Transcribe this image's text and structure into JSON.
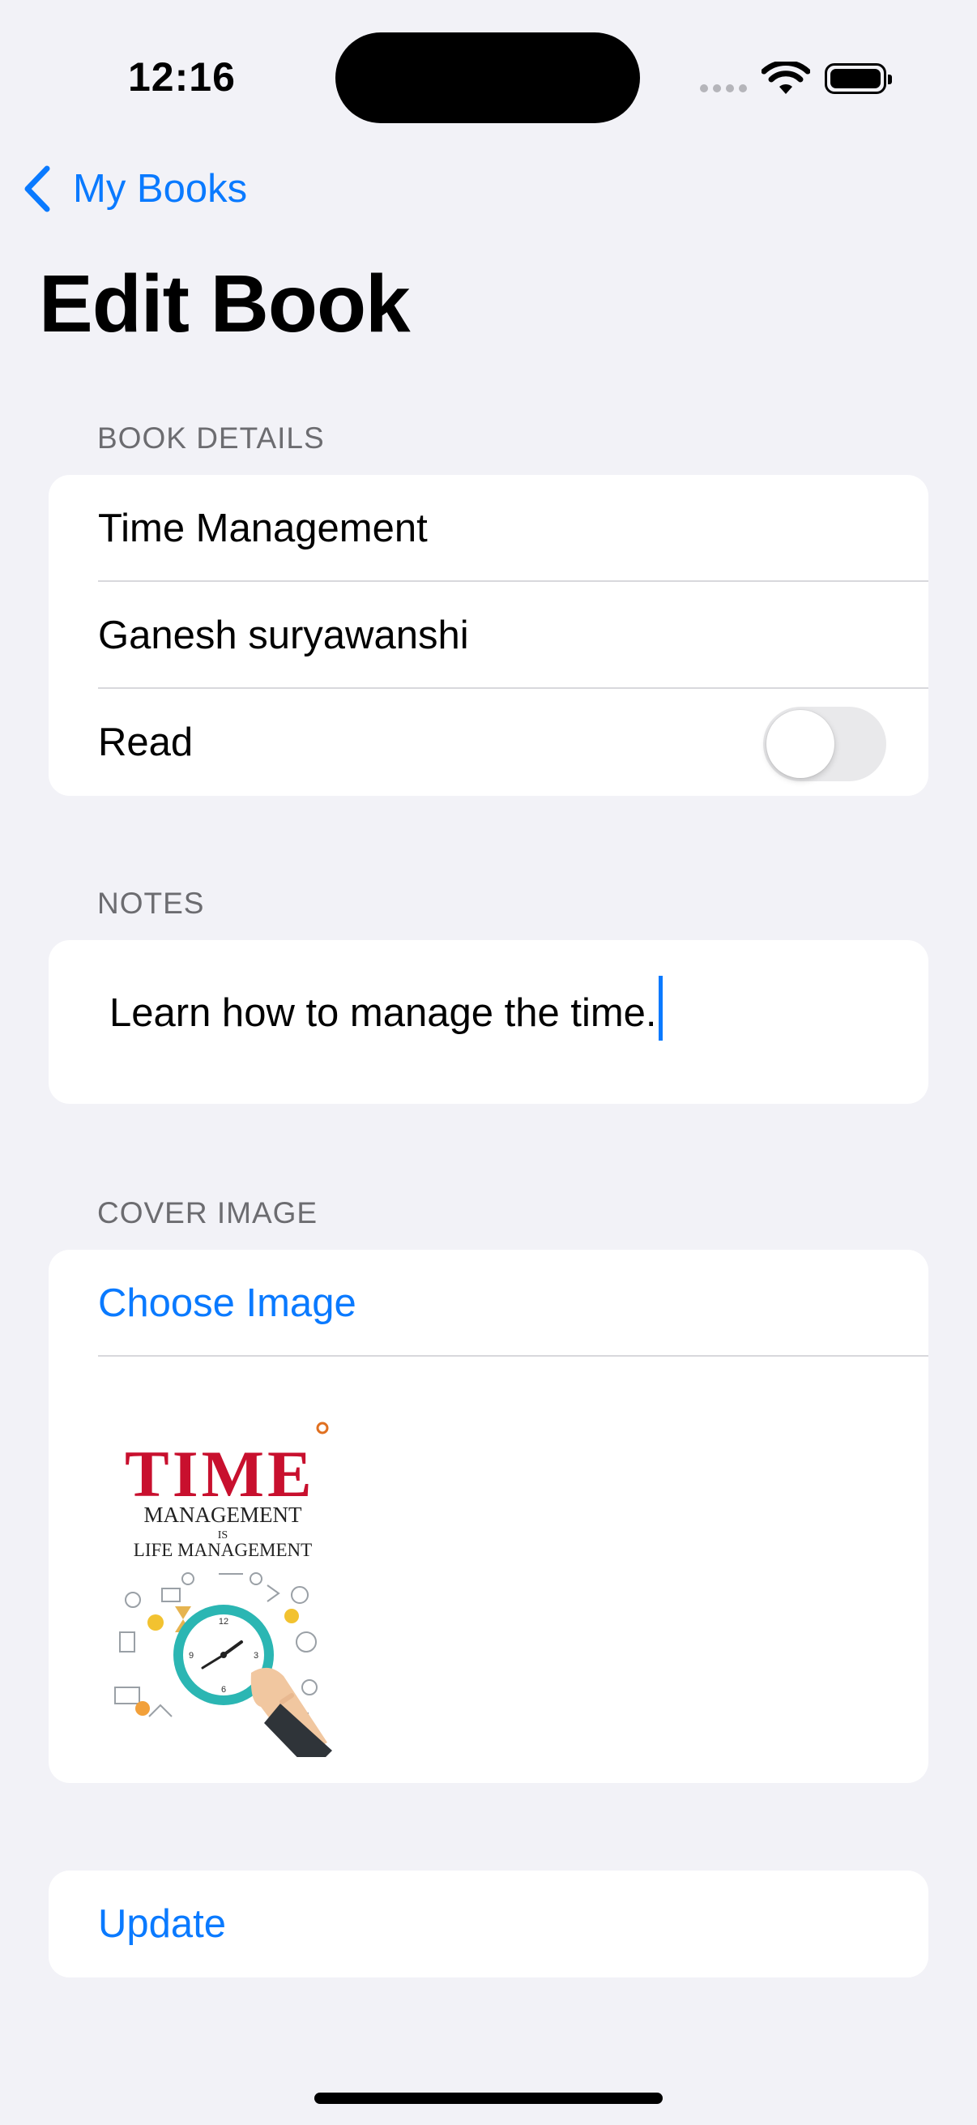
{
  "status_bar": {
    "time": "12:16",
    "wifi_icon": "wifi-icon",
    "battery_icon": "battery-full-icon"
  },
  "nav": {
    "back_label": "My Books",
    "back_icon": "chevron-left-icon",
    "title": "Edit Book"
  },
  "book_details": {
    "header": "BOOK DETAILS",
    "title_value": "Time Management",
    "author_value": "Ganesh suryawanshi",
    "read_label": "Read",
    "read_on": false
  },
  "notes": {
    "header": "NOTES",
    "text": "Learn how to manage the time."
  },
  "cover_image": {
    "header": "COVER IMAGE",
    "choose_label": "Choose Image",
    "book_cover": {
      "title_word": "TIME",
      "line1": "MANAGEMENT",
      "line2": "IS",
      "line3": "LIFE MANAGEMENT"
    }
  },
  "actions": {
    "update_label": "Update"
  },
  "colors": {
    "accent": "#0a7aff",
    "background": "#f2f2f7",
    "card": "#ffffff",
    "secondary_text": "#6c6c70",
    "cover_red": "#c8102e",
    "clock_teal": "#2bb6b3"
  }
}
